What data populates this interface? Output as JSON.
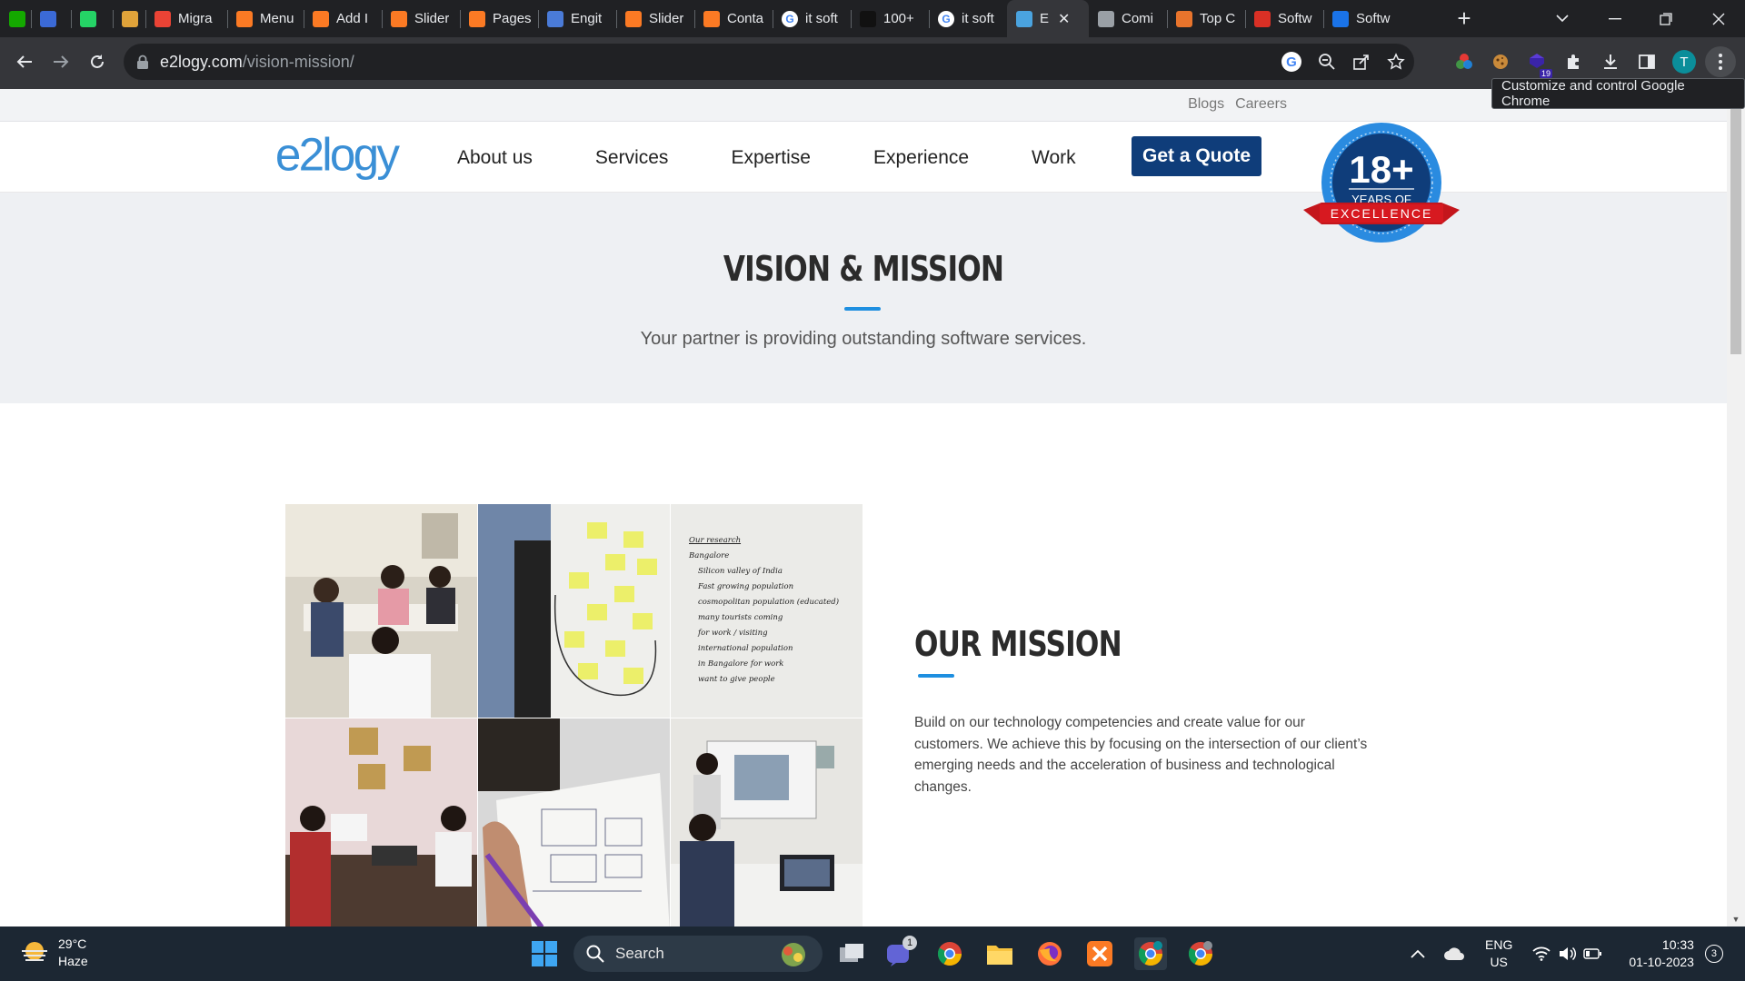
{
  "browser": {
    "tabs": [
      {
        "icon": "upwork-icon",
        "title": "",
        "color": "#14a800"
      },
      {
        "icon": "gear-tab-icon",
        "title": "",
        "color": "#3b6ad6"
      },
      {
        "icon": "whatsapp-icon",
        "title": "",
        "color": "#25d366"
      },
      {
        "icon": "mountain-logo-icon",
        "title": "",
        "color": "#e0a33a"
      },
      {
        "icon": "gmail-icon",
        "title": "Migra",
        "color": "#ea4335"
      },
      {
        "icon": "xampp-icon",
        "title": "Menu",
        "color": "#fb7a24"
      },
      {
        "icon": "xampp-icon",
        "title": "Add I",
        "color": "#fb7a24"
      },
      {
        "icon": "xampp-icon",
        "title": "Slider",
        "color": "#fb7a24"
      },
      {
        "icon": "xampp-icon",
        "title": "Pages",
        "color": "#fb7a24"
      },
      {
        "icon": "layers-icon",
        "title": "Engit",
        "color": "#4a7bd8"
      },
      {
        "icon": "xampp-icon",
        "title": "Slider",
        "color": "#fb7a24"
      },
      {
        "icon": "xampp-icon",
        "title": "Conta",
        "color": "#fb7a24"
      },
      {
        "icon": "google-icon",
        "title": "it soft",
        "color": "#ffffff"
      },
      {
        "icon": "black-square-icon",
        "title": "100+",
        "color": "#111111"
      },
      {
        "icon": "google-icon",
        "title": "it soft",
        "color": "#ffffff"
      },
      {
        "icon": "e2logy-icon",
        "title": "E",
        "color": "#4aa3df",
        "active": true
      },
      {
        "icon": "globe-icon",
        "title": "Comi",
        "color": "#9aa0a6"
      },
      {
        "icon": "orange-logo-icon",
        "title": "Top C",
        "color": "#e8742c"
      },
      {
        "icon": "red-triangle-icon",
        "title": "Softw",
        "color": "#d93025"
      },
      {
        "icon": "blue-x-icon",
        "title": "Softw",
        "color": "#1a73e8"
      }
    ],
    "url_host": "e2logy.com",
    "url_path": "/vision-mission/",
    "tooltip": "Customize and control Google Chrome",
    "profile_initial": "T",
    "extension_badge": "19"
  },
  "site": {
    "top_links": [
      "Blogs",
      "Careers"
    ],
    "logo_text": "e2logy",
    "nav": [
      "About us",
      "Services",
      "Expertise",
      "Experience",
      "Work"
    ],
    "quote_button": "Get a Quote",
    "badge": {
      "number": "18+",
      "line1": "YEARS OF",
      "ribbon": "EXCELLENCE"
    },
    "hero_title": "VISION & MISSION",
    "hero_subtitle": "Your partner is providing outstanding software services.",
    "mission_title": "OUR MISSION",
    "mission_text": "Build on our technology competencies and create value for our customers. We achieve this by focusing on the intersection of our client’s emerging needs and the acceleration of business and technological changes.",
    "whiteboard_lines": [
      "Our research",
      "Bangalore",
      "Silicon valley of India",
      "Fast growing population",
      "cosmopolitan population (educated)",
      "many tourists coming",
      "for work / visiting",
      "international population",
      "in Bangalore for work",
      "want to give people"
    ]
  },
  "taskbar": {
    "temperature": "29°C",
    "condition": "Haze",
    "search_placeholder": "Search",
    "lang1": "ENG",
    "lang2": "US",
    "time": "10:33",
    "date": "01-10-2023",
    "notif_count": "3",
    "teams_badge": "1"
  },
  "colors": {
    "accent": "#1e8fe0",
    "quote_btn": "#0f3d7a",
    "hero_bg": "#eef0f3"
  }
}
